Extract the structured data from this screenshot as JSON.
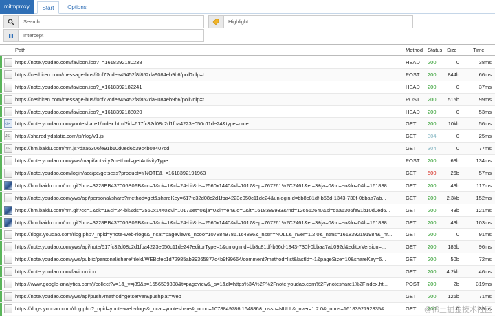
{
  "nav": {
    "brand": "mitmproxy",
    "tabs": [
      {
        "label": "Start"
      },
      {
        "label": "Options"
      }
    ]
  },
  "filters": {
    "search_placeholder": "Search",
    "highlight_placeholder": "Highlight",
    "intercept_placeholder": "Intercept"
  },
  "table": {
    "headers": {
      "path": "Path",
      "method": "Method",
      "status": "Status",
      "size": "Size",
      "time": "Time"
    },
    "rows": [
      {
        "icon": "plain",
        "path": "https://note.youdao.com/favicon.ico?_=1618392180238",
        "method": "HEAD",
        "status": "200",
        "size": "0",
        "time": "38ms"
      },
      {
        "icon": "plain",
        "path": "https://ceshiren.com/message-bus/f0cf72cdea45452f8f852da9084eb9b6/poll?dlp=t",
        "method": "POST",
        "status": "200",
        "size": "844b",
        "time": "66ms"
      },
      {
        "icon": "plain",
        "path": "https://note.youdao.com/favicon.ico?_=1618392182241",
        "method": "HEAD",
        "status": "200",
        "size": "0",
        "time": "37ms"
      },
      {
        "icon": "plain",
        "path": "https://ceshiren.com/message-bus/f0cf72cdea45452f8f852da9084eb9b6/poll?dlp=t",
        "method": "POST",
        "status": "200",
        "size": "515b",
        "time": "99ms"
      },
      {
        "icon": "plain",
        "path": "https://note.youdao.com/favicon.ico?_=1618392188020",
        "method": "HEAD",
        "status": "200",
        "size": "0",
        "time": "53ms"
      },
      {
        "icon": "html",
        "path": "https://note.youdao.com/ynoteshare1/index.html?id=617fc32d08c2d1fba4223e050c11de24&type=note",
        "method": "GET",
        "status": "200",
        "size": "10kb",
        "time": "56ms"
      },
      {
        "icon": "js",
        "path": "https://shared.ydstatic.com/js/rlog/v1.js",
        "method": "GET",
        "status": "304",
        "size": "0",
        "time": "25ms"
      },
      {
        "icon": "js",
        "path": "https://hm.baidu.com/hm.js?daa6306fe91b10d0ed6b39c4b0a407cd",
        "method": "GET",
        "status": "304",
        "size": "0",
        "time": "77ms"
      },
      {
        "icon": "plain",
        "path": "https://note.youdao.com/yws/mapi/activity?method=getActivityType",
        "method": "POST",
        "status": "200",
        "size": "68b",
        "time": "134ms"
      },
      {
        "icon": "plain",
        "path": "https://note.youdao.com/login/acc/pe/getsess?product=YNOTE&_=1618392191963",
        "method": "GET",
        "status": "500",
        "size": "26b",
        "time": "57ms"
      },
      {
        "icon": "img",
        "path": "https://hm.baidu.com/hm.gif?hca=3228EB437006B0FB&cc=1&ck=1&cl=24-bit&ds=2560x1440&vl=1017&ep=767261%2C2461&et=3&ja=0&ln=en&lo=0&lt=161838...",
        "method": "GET",
        "status": "200",
        "size": "43b",
        "time": "117ms"
      },
      {
        "icon": "plain",
        "path": "https://note.youdao.com/yws/api/personal/share?method=get&shareKey=617fc32d08c2d1fba4223e050c11de24&unloginId=bb8c81df-b56d-1343-730f-0bbaa7ab...",
        "method": "GET",
        "status": "200",
        "size": "2,3kb",
        "time": "152ms"
      },
      {
        "icon": "img",
        "path": "https://hm.baidu.com/hm.gif?cc=1&ck=1&cl=24-bit&ds=2560x1440&vl=1017&et=0&ja=0&ln=en&lo=0&lt=1618389933&rnd=126562640&si=daa6306fe91b10d0ed6...",
        "method": "GET",
        "status": "200",
        "size": "43b",
        "time": "121ms"
      },
      {
        "icon": "img",
        "path": "https://hm.baidu.com/hm.gif?hca=3228EB437006B0FB&cc=1&ck=1&cl=24-bit&ds=2560x1440&vl=1017&ep=767261%2C2461&et=3&ja=0&ln=en&lo=0&lt=161838...",
        "method": "GET",
        "status": "200",
        "size": "43b",
        "time": "103ms"
      },
      {
        "icon": "plain",
        "path": "https://rlogs.youdao.com/rlog.php?_npid=ynote-web-rlogs&_ncat=pageview&_ncoo=1078849786.164886&_nssn=NULL&_nver=1.2.0&_ntms=1618392191984&_nr...",
        "method": "GET",
        "status": "200",
        "size": "0",
        "time": "91ms"
      },
      {
        "icon": "plain",
        "path": "https://note.youdao.com/yws/api/note/617fc32d08c2d1fba4223e050c11de24?editorType=1&unloginId=bb8c81df-b56d-1343-730f-0bbaa7ab092d&editorVersion=...",
        "method": "GET",
        "status": "200",
        "size": "185b",
        "time": "96ms"
      },
      {
        "icon": "plain",
        "path": "https://note.youdao.com/yws/public/personal/share/fileId/WEBcfec1d72985ab39365877c4b9f99664/comment?method=list&lastId=-1&pageSize=10&shareKey=6...",
        "method": "GET",
        "status": "200",
        "size": "50b",
        "time": "72ms"
      },
      {
        "icon": "plain",
        "path": "https://note.youdao.com/favicon.ico",
        "method": "GET",
        "status": "200",
        "size": "4.2kb",
        "time": "46ms"
      },
      {
        "icon": "plain",
        "path": "https://www.google-analytics.com/j/collect?v=1&_v=j89&a=1556539308&t=pageview&_s=1&dl=https%3A%2F%2Fnote.youdao.com%2Fynoteshare1%2Findex.ht...",
        "method": "POST",
        "status": "200",
        "size": "2b",
        "time": "319ms"
      },
      {
        "icon": "plain",
        "path": "https://note.youdao.com/yws/api/push?method=getserver&pushplat=web",
        "method": "GET",
        "status": "200",
        "size": "126b",
        "time": "71ms"
      },
      {
        "icon": "plain",
        "path": "https://rlogs.youdao.com/rlog.php?_npid=ynote-web-rlogs&_ncat=ynoteshare&_ncoo=1078849786.164886&_nssn=NULL&_nver=1.2.0&_ntms=1618392192335&...",
        "method": "GET",
        "status": "200",
        "size": "0",
        "time": "39ms"
      },
      {
        "icon": "plain",
        "path": "https://note.youdao.com/md/index.appcache",
        "method": "GET",
        "status": "200",
        "size": "175b",
        "time": "33ms"
      }
    ]
  },
  "watermark": "@稀土掘金技术社区"
}
